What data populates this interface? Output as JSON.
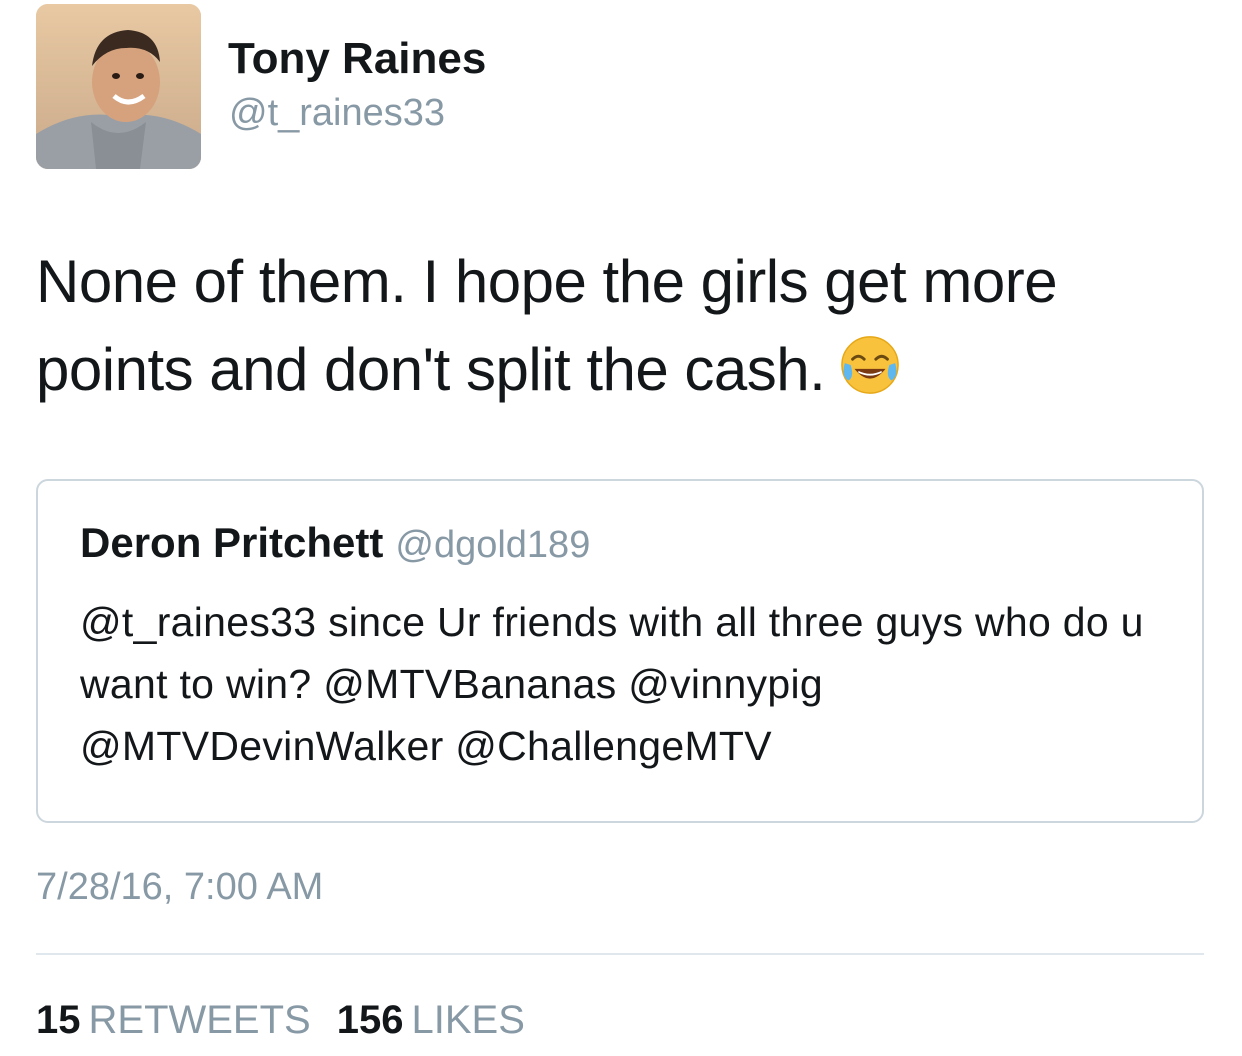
{
  "author": {
    "display_name": "Tony Raines",
    "handle": "@t_raines33",
    "avatar_icon": "profile-photo"
  },
  "tweet": {
    "text": "None of them. I hope the girls get more points and don't split the cash.",
    "emoji": "face-with-tears-of-joy"
  },
  "quoted_tweet": {
    "display_name": "Deron Pritchett",
    "handle": "@dgold189",
    "text": "@t_raines33 since Ur friends with all three guys who do u want to win? @MTVBananas @vinnypig @MTVDevinWalker @ChallengeMTV"
  },
  "timestamp": "7/28/16, 7:00 AM",
  "stats": {
    "retweets_count": "15",
    "retweets_label": "RETWEETS",
    "likes_count": "156",
    "likes_label": "LIKES"
  },
  "colors": {
    "primary_text": "#14171a",
    "secondary_text": "#8899a6",
    "border": "#ccd6dd"
  }
}
